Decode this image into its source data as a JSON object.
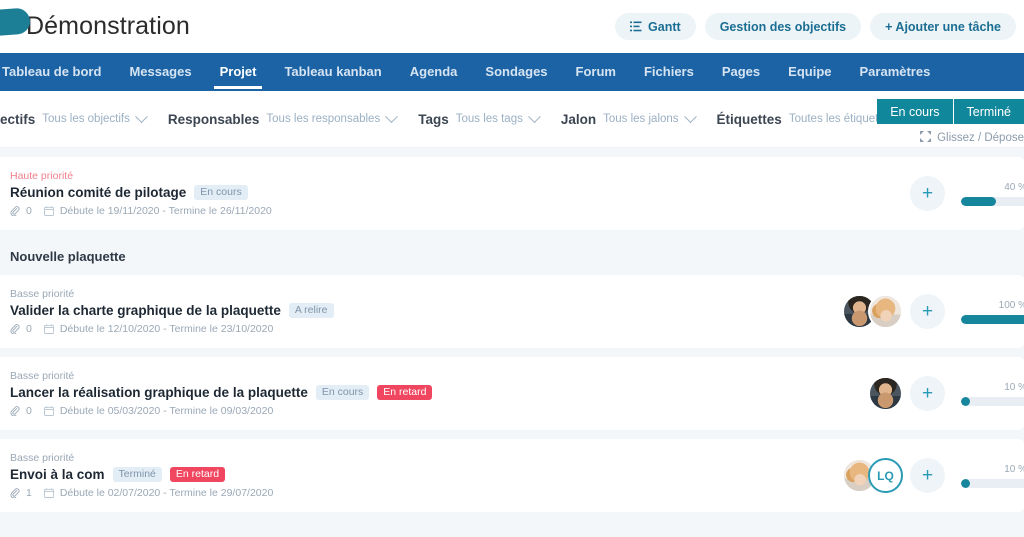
{
  "header": {
    "title": "Démonstration",
    "logo_icon": "leaf-logo-icon",
    "actions": [
      {
        "label": "Gantt",
        "icon": "gantt-list-icon"
      },
      {
        "label": "Gestion des objectifs",
        "icon": ""
      },
      {
        "label": "+ Ajouter une tâche",
        "icon": "plus-icon"
      }
    ]
  },
  "nav": {
    "items": [
      {
        "label": "Tableau de bord",
        "active": false
      },
      {
        "label": "Messages",
        "active": false
      },
      {
        "label": "Projet",
        "active": true
      },
      {
        "label": "Tableau kanban",
        "active": false
      },
      {
        "label": "Agenda",
        "active": false
      },
      {
        "label": "Sondages",
        "active": false
      },
      {
        "label": "Forum",
        "active": false
      },
      {
        "label": "Fichiers",
        "active": false
      },
      {
        "label": "Pages",
        "active": false
      },
      {
        "label": "Equipe",
        "active": false
      },
      {
        "label": "Paramètres",
        "active": false
      }
    ]
  },
  "filters": {
    "groups": [
      {
        "label": "ectifs",
        "value": "Tous les objectifs"
      },
      {
        "label": "Responsables",
        "value": "Tous les responsables"
      },
      {
        "label": "Tags",
        "value": "Tous les tags"
      },
      {
        "label": "Jalon",
        "value": "Tous les jalons"
      },
      {
        "label": "Étiquettes",
        "value": "Toutes les étiquettes"
      }
    ],
    "segments": [
      {
        "label": "En cours",
        "selected": true
      },
      {
        "label": "Terminé",
        "selected": true
      }
    ],
    "dragdrop_label": "Glissez / Dépose",
    "dragdrop_icon": "move-arrows-icon"
  },
  "tasks": [
    {
      "priority": "Haute priorité",
      "priority_level": "high",
      "title": "Réunion comité de pilotage",
      "badges": [
        {
          "text": "En cours",
          "type": "status"
        }
      ],
      "attachments": "0",
      "dates": "Débute le 19/11/2020 - Termine le 26/11/2020",
      "avatars": [],
      "progress": 40,
      "progress_label": "40 %"
    },
    {
      "priority": "Basse priorité",
      "priority_level": "low",
      "title": "Valider la charte graphique de la plaquette",
      "badges": [
        {
          "text": "A relire",
          "type": "status"
        }
      ],
      "attachments": "0",
      "dates": "Débute le 12/10/2020 - Termine le 23/10/2020",
      "avatars": [
        {
          "kind": "photo",
          "style": "m1",
          "name": "avatar-photo-male"
        },
        {
          "kind": "photo",
          "style": "f1",
          "name": "avatar-photo-female"
        }
      ],
      "progress": 100,
      "progress_label": "100 %"
    },
    {
      "priority": "Basse priorité",
      "priority_level": "low",
      "title": "Lancer la réalisation graphique de la plaquette",
      "badges": [
        {
          "text": "En cours",
          "type": "status"
        },
        {
          "text": "En retard",
          "type": "late"
        }
      ],
      "attachments": "0",
      "dates": "Débute le 05/03/2020 - Termine le 09/03/2020",
      "avatars": [
        {
          "kind": "photo",
          "style": "m1",
          "name": "avatar-photo-male"
        }
      ],
      "progress": 10,
      "progress_label": "10 %"
    },
    {
      "priority": "Basse priorité",
      "priority_level": "low",
      "title": "Envoi à la com",
      "badges": [
        {
          "text": "Terminé",
          "type": "status"
        },
        {
          "text": "En retard",
          "type": "late"
        }
      ],
      "attachments": "1",
      "dates": "Débute le 02/07/2020 - Termine le 29/07/2020",
      "avatars": [
        {
          "kind": "photo",
          "style": "f1",
          "name": "avatar-photo-female"
        },
        {
          "kind": "initials",
          "text": "LQ",
          "name": "avatar-initials"
        }
      ],
      "progress": 10,
      "progress_label": "10 %"
    }
  ],
  "section_header": {
    "label": "Nouvelle plaquette",
    "after_task_index": 0
  },
  "colors": {
    "nav_blue": "#1b63a5",
    "teal": "#16869c",
    "accent_link": "#1b6e93",
    "late_red": "#f0465f",
    "high_priority": "#f0808c",
    "page_bg": "#f4f7fa"
  }
}
